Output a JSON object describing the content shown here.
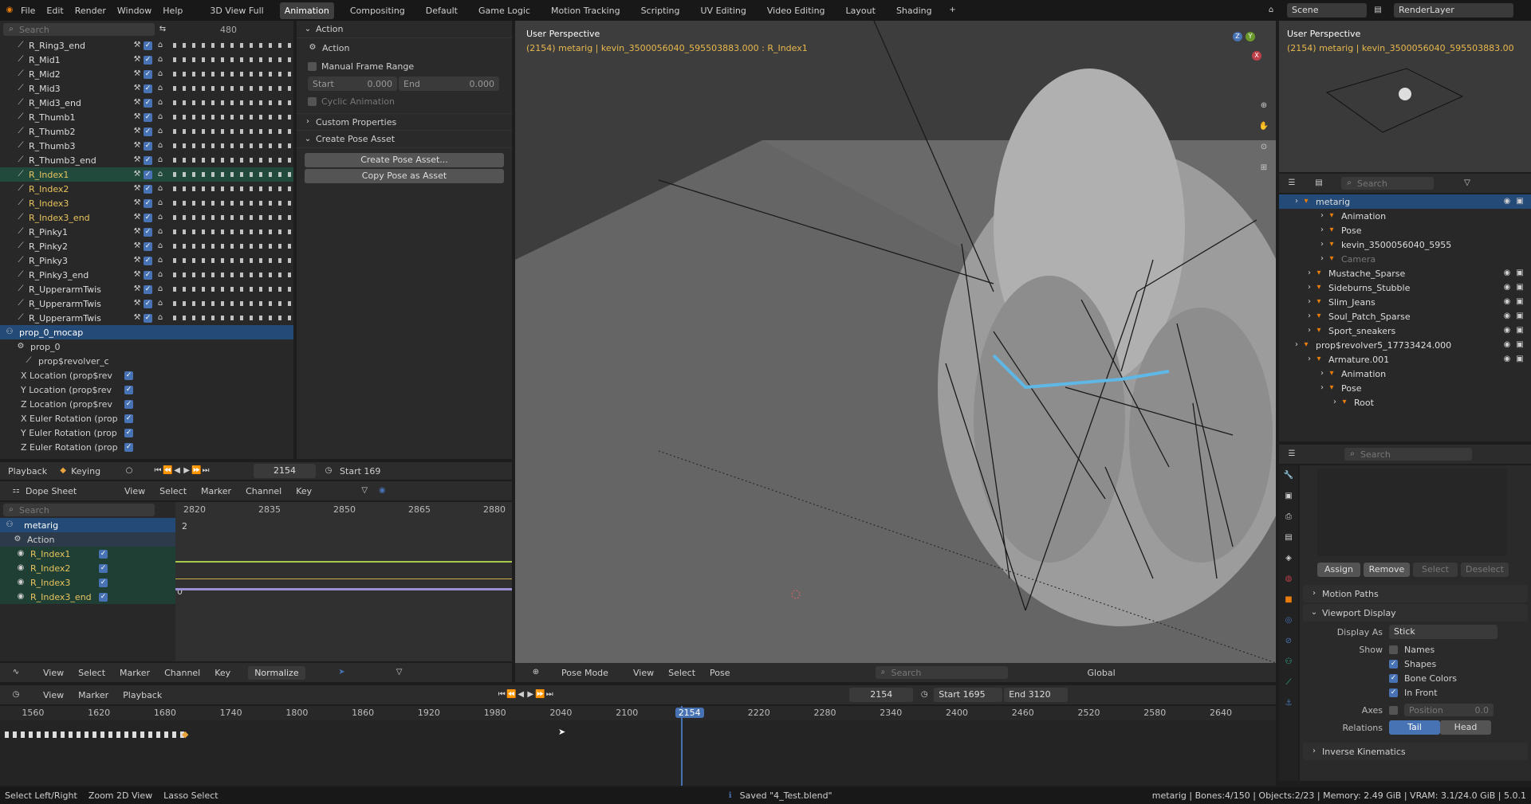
{
  "top_menu": {
    "items": [
      "File",
      "Edit",
      "Render",
      "Window",
      "Help"
    ],
    "workspaces": [
      "3D View Full",
      "Animation",
      "Compositing",
      "Default",
      "Game Logic",
      "Motion Tracking",
      "Scripting",
      "UV Editing",
      "Video Editing",
      "Layout",
      "Shading"
    ],
    "active_workspace": "Animation",
    "scene": "Scene",
    "view_layer": "RenderLayer"
  },
  "channels": {
    "search_placeholder": "Search",
    "frame_label": "480",
    "rows": [
      "R_Ring3_end",
      "R_Mid1",
      "R_Mid2",
      "R_Mid3",
      "R_Mid3_end",
      "R_Thumb1",
      "R_Thumb2",
      "R_Thumb3",
      "R_Thumb3_end",
      "R_Index1",
      "R_Index2",
      "R_Index3",
      "R_Index3_end",
      "R_Pinky1",
      "R_Pinky2",
      "R_Pinky3",
      "R_Pinky3_end",
      "R_UpperarmTwis",
      "R_UpperarmTwis",
      "R_UpperarmTwis"
    ],
    "prop_object": "prop_0_mocap",
    "prop_action": "prop_0",
    "prop_group": "prop$revolver_c",
    "prop_channels": [
      "X Location (prop$rev",
      "Y Location (prop$rev",
      "Z Location (prop$rev",
      "X Euler Rotation (prop",
      "Y Euler Rotation (prop",
      "Z Euler Rotation (prop"
    ]
  },
  "action_panel": {
    "title": "Action",
    "action_label": "Action",
    "manual_frame_range": "Manual Frame Range",
    "start_label": "Start",
    "start_value": "0.000",
    "end_label": "End",
    "end_value": "0.000",
    "cyclic": "Cyclic Animation",
    "custom_properties": "Custom Properties",
    "create_pose_asset": "Create Pose Asset",
    "create_btn": "Create Pose Asset...",
    "copy_btn": "Copy Pose as Asset"
  },
  "playback_bar": {
    "playback": "Playback",
    "keying": "Keying",
    "frame": "2154",
    "start": "Start 169"
  },
  "dopesheet": {
    "mode": "Dope Sheet",
    "menus": [
      "View",
      "Select",
      "Marker",
      "Channel",
      "Key"
    ],
    "search_placeholder": "Search",
    "ticks": [
      "2820",
      "2835",
      "2850",
      "2865",
      "2880"
    ],
    "object": "metarig",
    "action": "Action",
    "channels": [
      "R_Index1",
      "R_Index2",
      "R_Index3",
      "R_Index3_end"
    ],
    "value_2": "2",
    "value_0": "0"
  },
  "graph": {
    "menus": [
      "View",
      "Select",
      "Marker",
      "Channel",
      "Key"
    ],
    "normalize": "Normalize"
  },
  "viewport": {
    "title": "User Perspective",
    "info": "(2154) metarig | kevin_3500056040_595503883.000 : R_Index1",
    "mode": "Pose Mode",
    "menus": [
      "View",
      "Select",
      "Pose"
    ],
    "search_placeholder": "Search",
    "orientation": "Global"
  },
  "mini_viewport": {
    "title": "User Perspective",
    "info": "(2154) metarig | kevin_3500056040_595503883.00"
  },
  "outliner": {
    "search_placeholder": "Search",
    "items": [
      {
        "label": "metarig",
        "indent": 1,
        "sel": true
      },
      {
        "label": "Animation",
        "indent": 3
      },
      {
        "label": "Pose",
        "indent": 3
      },
      {
        "label": "kevin_3500056040_5955",
        "indent": 3
      },
      {
        "label": "Camera",
        "indent": 3,
        "dim": true
      },
      {
        "label": "Mustache_Sparse",
        "indent": 2
      },
      {
        "label": "Sideburns_Stubble",
        "indent": 2
      },
      {
        "label": "Slim_Jeans",
        "indent": 2
      },
      {
        "label": "Soul_Patch_Sparse",
        "indent": 2
      },
      {
        "label": "Sport_sneakers",
        "indent": 2
      },
      {
        "label": "prop$revolver5_17733424.000",
        "indent": 1
      },
      {
        "label": "Armature.001",
        "indent": 2
      },
      {
        "label": "Animation",
        "indent": 3
      },
      {
        "label": "Pose",
        "indent": 3
      },
      {
        "label": "Root",
        "indent": 4
      }
    ]
  },
  "properties": {
    "search_placeholder": "Search",
    "assign": "Assign",
    "remove": "Remove",
    "select": "Select",
    "deselect": "Deselect",
    "motion_paths": "Motion Paths",
    "viewport_display": "Viewport Display",
    "display_as_label": "Display As",
    "display_as": "Stick",
    "show": "Show",
    "names": "Names",
    "shapes": "Shapes",
    "bone_colors": "Bone Colors",
    "in_front": "In Front",
    "axes": "Axes",
    "position": "Position",
    "position_value": "0.0",
    "relations": "Relations",
    "tail": "Tail",
    "head": "Head",
    "inverse_kinematics": "Inverse Kinematics"
  },
  "timeline": {
    "menus": [
      "View",
      "Marker",
      "Playback"
    ],
    "frame": "2154",
    "start": "Start",
    "start_value": "1695",
    "end": "End",
    "end_value": "3120",
    "ticks": [
      "1560",
      "1620",
      "1680",
      "1740",
      "1800",
      "1860",
      "1920",
      "1980",
      "2040",
      "2100",
      "2154",
      "2220",
      "2280",
      "2340",
      "2400",
      "2460",
      "2520",
      "2580",
      "2640"
    ]
  },
  "status": {
    "left": [
      "Select Left/Right",
      "Zoom 2D View",
      "Lasso Select"
    ],
    "message": "Saved \"4_Test.blend\"",
    "right": "metarig | Bones:4/150 | Objects:2/23 | Memory: 2.49 GiB | VRAM: 3.1/24.0 GiB | 5.0.1"
  },
  "colors": {
    "accent": "#4772b3",
    "selected_row": "#214a3d",
    "active_object": "#244a77",
    "bone_highlight": "#5fb7e6",
    "key_orange": "#e8a33d"
  }
}
